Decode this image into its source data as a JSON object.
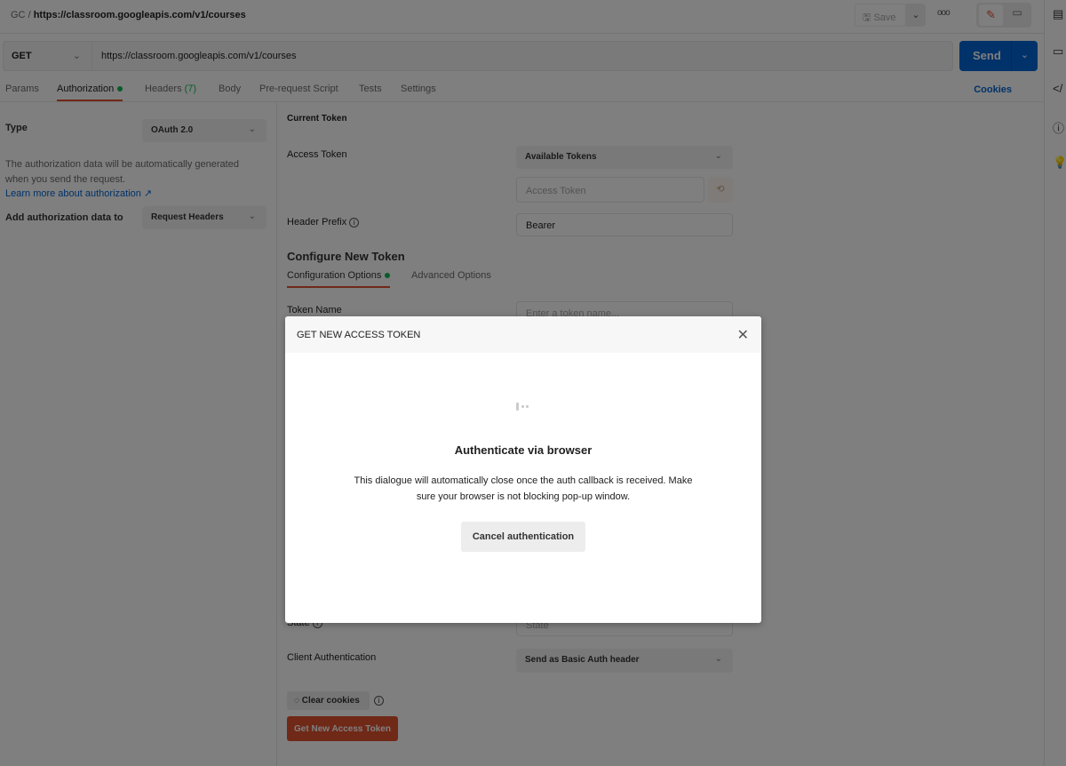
{
  "header": {
    "collection": "GC",
    "separator": "/",
    "request_name": "https://classroom.googleapis.com/v1/courses",
    "save_label": "Save",
    "more_label": "ooo"
  },
  "request": {
    "method": "GET",
    "url": "https://classroom.googleapis.com/v1/courses",
    "send_label": "Send"
  },
  "tabs": [
    {
      "label": "Params"
    },
    {
      "label": "Authorization"
    },
    {
      "label": "Headers",
      "count": "(7)"
    },
    {
      "label": "Body"
    },
    {
      "label": "Pre-request Script"
    },
    {
      "label": "Tests"
    },
    {
      "label": "Settings"
    }
  ],
  "cookies_label": "Cookies",
  "left": {
    "type_label": "Type",
    "type_value": "OAuth 2.0",
    "description": "The authorization data will be automatically generated when you send the request.",
    "learn_more": "Learn more about authorization ↗",
    "add_to_label": "Add authorization data to",
    "add_to_value": "Request Headers"
  },
  "current_token": {
    "heading": "Current Token",
    "access_token_label": "Access Token",
    "available_tokens": "Available Tokens",
    "access_token_placeholder": "Access Token",
    "header_prefix_label": "Header Prefix",
    "header_prefix_value": "Bearer"
  },
  "configure": {
    "heading": "Configure New Token",
    "tabs": [
      {
        "label": "Configuration Options"
      },
      {
        "label": "Advanced Options"
      }
    ],
    "token_name_label": "Token Name",
    "token_name_placeholder": "Enter a token name...",
    "state_label": "State",
    "state_placeholder": "State",
    "client_auth_label": "Client Authentication",
    "client_auth_value": "Send as Basic Auth header",
    "clear_cookies": "Clear cookies",
    "get_token": "Get New Access Token"
  },
  "modal": {
    "title": "GET NEW ACCESS TOKEN",
    "heading": "Authenticate via browser",
    "message": "This dialogue will automatically close once the auth callback is received. Make sure your browser is not blocking pop-up window.",
    "cancel_label": "Cancel authentication"
  },
  "colors": {
    "accent": "#e0502f",
    "primary": "#0265d2",
    "success": "#0cbb52"
  }
}
